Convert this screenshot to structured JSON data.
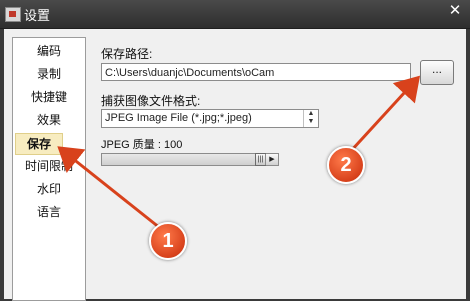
{
  "window": {
    "title": "设置",
    "close_glyph": "✕"
  },
  "sidebar": {
    "items": [
      {
        "label": "编码"
      },
      {
        "label": "录制"
      },
      {
        "label": "快捷键"
      },
      {
        "label": "效果"
      },
      {
        "label": "保存",
        "selected": true
      },
      {
        "label": "时间限制"
      },
      {
        "label": "水印"
      },
      {
        "label": "语言"
      }
    ]
  },
  "save_path": {
    "label": "保存路径:",
    "value": "C:\\Users\\duanjc\\Documents\\oCam",
    "browse_label": "..."
  },
  "image_format": {
    "label": "捕获图像文件格式:",
    "selected": "JPEG Image File (*.jpg;*.jpeg)"
  },
  "jpeg_quality": {
    "label": "JPEG 质量 : 100",
    "value": 100,
    "max": 100
  },
  "annotations": [
    {
      "label": "1"
    },
    {
      "label": "2"
    }
  ],
  "colors": {
    "accent_arrow": "#d8421c",
    "selected_bg": "#f7ecc0"
  }
}
